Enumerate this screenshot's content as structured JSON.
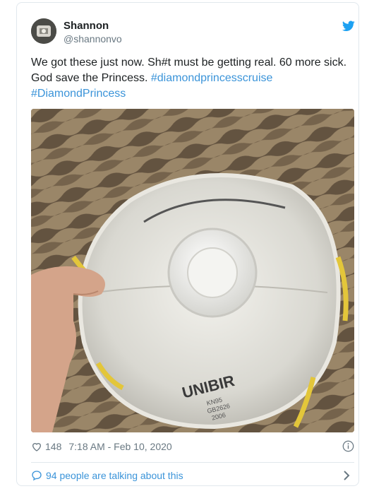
{
  "user": {
    "name": "Shannon",
    "handle": "@shannonvo"
  },
  "tweet": {
    "text_plain": "We got these just now. Sh#t must be getting real. 60 more sick. God save the Princess.",
    "hashtag_1": "#diamondprincesscruise",
    "hashtag_2": "#DiamondPrincess"
  },
  "photo": {
    "mask_brand": "UNIBIR",
    "mask_print_lines": [
      "KN95",
      "GB2626",
      "2006"
    ]
  },
  "meta": {
    "likes": "148",
    "timestamp": "7:18 AM - Feb 10, 2020"
  },
  "footer": {
    "talking_text": "94 people are talking about this"
  },
  "icons": {
    "bird": "twitter-bird-icon",
    "heart": "heart-icon",
    "info": "info-icon",
    "bubble": "speech-bubble-icon",
    "chevron": "chevron-right-icon"
  },
  "colors": {
    "link": "#3b94d9",
    "muted": "#697882",
    "twitter_blue": "#1da1f2",
    "border": "#e1e8ed"
  }
}
